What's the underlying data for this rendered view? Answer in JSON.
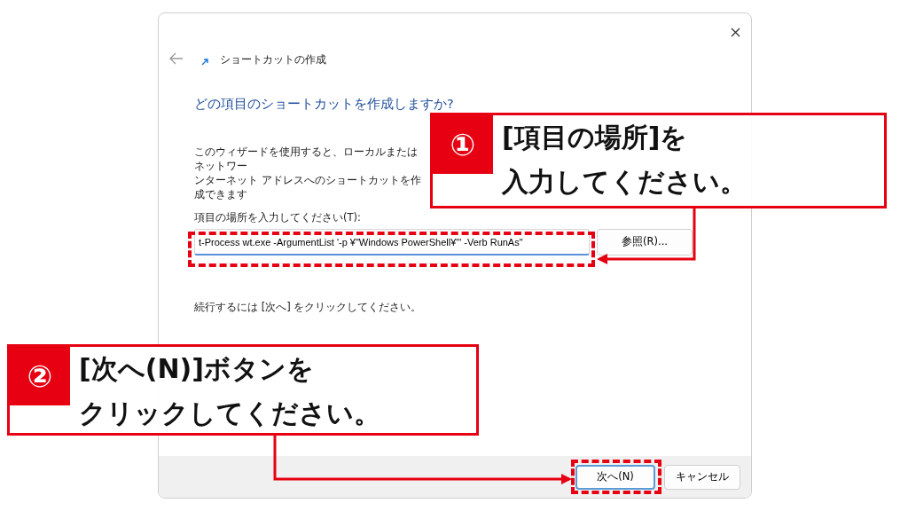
{
  "window": {
    "title": "ショートカットの作成"
  },
  "heading": "どの項目のショートカットを作成しますか?",
  "description": [
    "このウィザードを使用すると、ローカルまたはネットワー",
    "ンターネット アドレスへのショートカットを作成できます"
  ],
  "location": {
    "label": "項目の場所を入力してください(T):",
    "value": "t-Process wt.exe -ArgumentList '-p ¥\"Windows PowerShell¥\"' -Verb RunAs\"",
    "browse": "参照(R)..."
  },
  "continue_hint": "続行するには [次へ] をクリックしてください。",
  "buttons": [
    {
      "label": "次へ(N)",
      "default": true
    },
    {
      "label": "キャンセル",
      "default": false
    }
  ],
  "callouts": [
    {
      "number": "①",
      "lines": [
        "[項目の場所]を",
        "入力してください。"
      ]
    },
    {
      "number": "②",
      "lines": [
        "[次へ(N)]ボタンを",
        "クリックしてください。"
      ]
    }
  ]
}
